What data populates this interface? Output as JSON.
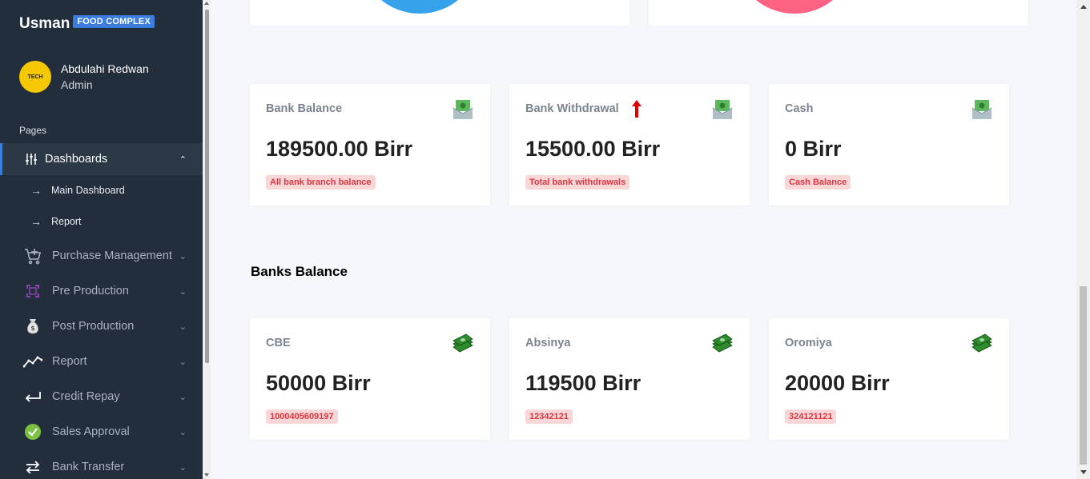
{
  "sidebar": {
    "brand": "Usman",
    "brand_badge": "FOOD COMPLEX",
    "user": {
      "name": "Abdulahi Redwan",
      "role": "Admin",
      "avatar_text": "TECH"
    },
    "section_header": "Pages",
    "active_item": {
      "label": "Dashboards",
      "icon": "sliders-icon"
    },
    "sub_items": [
      {
        "label": "Main Dashboard"
      },
      {
        "label": "Report"
      }
    ],
    "items": [
      {
        "label": "Purchase Management",
        "icon": "cart-plus-icon"
      },
      {
        "label": "Pre Production",
        "icon": "frame-icon"
      },
      {
        "label": "Post Production",
        "icon": "money-bag-icon"
      },
      {
        "label": "Report",
        "icon": "trend-line-icon"
      },
      {
        "label": "Credit Repay",
        "icon": "return-arrow-icon"
      },
      {
        "label": "Sales Approval",
        "icon": "check-badge-icon"
      },
      {
        "label": "Bank Transfer",
        "icon": "transfer-arrows-icon"
      }
    ]
  },
  "summary_cards": [
    {
      "title": "Bank Balance",
      "value": "189500.00 Birr",
      "badge": "All bank branch balance",
      "icon": "money-envelope-icon"
    },
    {
      "title": "Bank Withdrawal",
      "value": "15500.00 Birr",
      "badge": "Total bank withdrawals",
      "icon": "money-envelope-icon",
      "indicator": "up-arrow-icon"
    },
    {
      "title": "Cash",
      "value": "0 Birr",
      "badge": "Cash Balance",
      "icon": "money-envelope-icon"
    }
  ],
  "banks_section_title": "Banks Balance",
  "bank_cards": [
    {
      "title": "CBE",
      "value": "50000 Birr",
      "badge": "1000405609197",
      "icon": "money-stack-icon"
    },
    {
      "title": "Absinya",
      "value": "119500 Birr",
      "badge": "12342121",
      "icon": "money-stack-icon"
    },
    {
      "title": "Oromiya",
      "value": "20000 Birr",
      "badge": "324121121",
      "icon": "money-stack-icon"
    }
  ],
  "colors": {
    "sidebar_bg": "#222e3c",
    "accent": "#3b7ddd",
    "badge_text": "#d9373f",
    "badge_bg": "#f9d7d9",
    "pie_blue": "#36a2eb",
    "pie_pink": "#ff6384",
    "up_arrow": "#e00000"
  }
}
